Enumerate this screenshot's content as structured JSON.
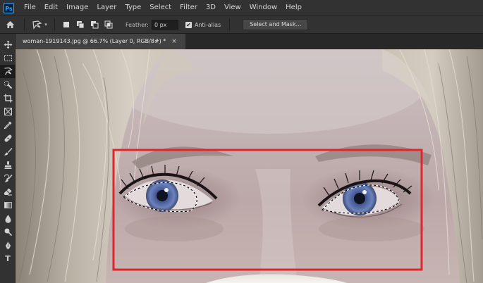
{
  "app": {
    "logo": "Ps"
  },
  "menu": [
    "File",
    "Edit",
    "Image",
    "Layer",
    "Type",
    "Select",
    "Filter",
    "3D",
    "View",
    "Window",
    "Help"
  ],
  "options": {
    "feather_label": "Feather:",
    "feather_value": "0 px",
    "antialias_label": "Anti-alias",
    "antialias_checked": "✔",
    "select_mask_label": "Select and Mask..."
  },
  "document": {
    "tab_title": "woman-1919143.jpg @ 66.7% (Layer 0, RGB/8#) *",
    "close_glyph": "×"
  },
  "tools": [
    "move-tool",
    "rectangular-marquee-tool",
    "lasso-tool",
    "quick-selection-tool",
    "crop-tool",
    "frame-tool",
    "eyedropper-tool",
    "healing-brush-tool",
    "brush-tool",
    "clone-stamp-tool",
    "history-brush-tool",
    "eraser-tool",
    "gradient-tool",
    "blur-tool",
    "dodge-tool",
    "pen-tool",
    "type-tool"
  ],
  "type_tool_glyph": "T",
  "colors": {
    "accent": "#31a8ff",
    "annotation_red": "#e0262b",
    "chrome_dark": "#323232"
  }
}
